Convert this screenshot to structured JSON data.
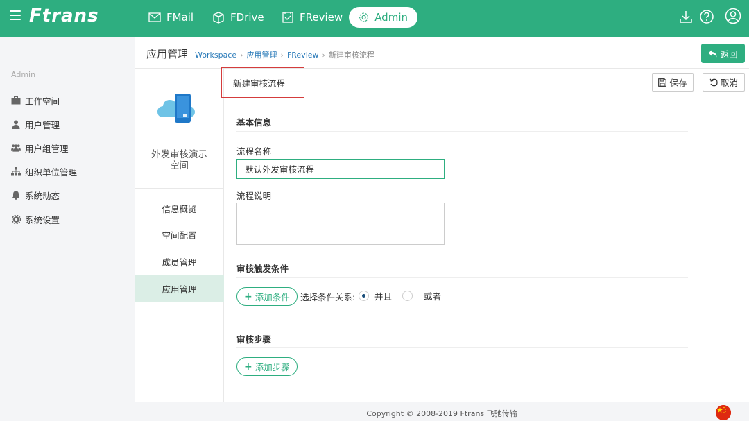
{
  "topbar": {
    "logo": "Ftrans",
    "nav": [
      {
        "label": "FMail",
        "icon": "mail-icon"
      },
      {
        "label": "FDrive",
        "icon": "box-icon"
      },
      {
        "label": "FReview",
        "icon": "checklist-icon"
      },
      {
        "label": "Admin",
        "icon": "gear-icon"
      }
    ],
    "right_icons": [
      "download-icon",
      "help-icon",
      "user-icon"
    ],
    "accent": "#2eae80"
  },
  "sidebar": {
    "heading": "Admin",
    "items": [
      {
        "label": "工作空间",
        "icon": "briefcase-icon"
      },
      {
        "label": "用户管理",
        "icon": "user-icon"
      },
      {
        "label": "用户组管理",
        "icon": "users-icon"
      },
      {
        "label": "组织单位管理",
        "icon": "org-chart-icon"
      },
      {
        "label": "系统动态",
        "icon": "bell-icon"
      },
      {
        "label": "系统设置",
        "icon": "gear-icon"
      }
    ]
  },
  "header": {
    "title": "应用管理",
    "breadcrumb": [
      "Workspace",
      "应用管理",
      "FReview",
      "新建审核流程"
    ],
    "back_label": "返回"
  },
  "space": {
    "name_line1": "外发审核演示",
    "name_line2": "空间",
    "nav": [
      "信息概览",
      "空间配置",
      "成员管理",
      "应用管理"
    ],
    "active_nav": "应用管理"
  },
  "form": {
    "title": "新建审核流程",
    "save_label": "保存",
    "cancel_label": "取消",
    "basic_section": "基本信息",
    "name_label": "流程名称",
    "name_value": "默认外发审核流程",
    "desc_label": "流程说明",
    "desc_value": "",
    "trigger_section": "审核触发条件",
    "add_condition": "添加条件",
    "relation_label": "选择条件关系:",
    "relation_and": "并且",
    "relation_or": "或者",
    "relation_selected": "并且",
    "steps_section": "审核步骤",
    "add_step": "添加步骤"
  },
  "footer": {
    "copyright": "Copyright © 2008-2019 Ftrans 飞驰传输"
  }
}
